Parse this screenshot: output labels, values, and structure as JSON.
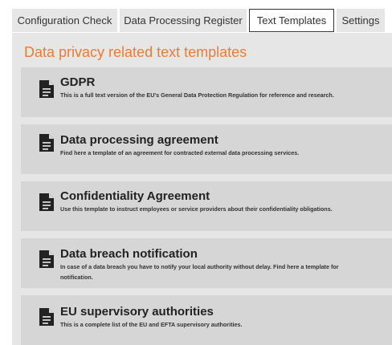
{
  "tabs": [
    {
      "label": "Configuration Check",
      "active": false
    },
    {
      "label": "Data Processing Register",
      "active": false
    },
    {
      "label": "Text Templates",
      "active": true
    },
    {
      "label": "Settings",
      "active": false
    }
  ],
  "page_title": "Data privacy related text templates",
  "accent_color": "#ee7b30",
  "templates": [
    {
      "icon": "document-icon",
      "title": "GDPR",
      "description": "This is a full text version of the EU's General Data Protection Regulation for reference and research."
    },
    {
      "icon": "document-icon",
      "title": "Data processing agreement",
      "description": "Find here a template of an agreement for contracted external data processing services."
    },
    {
      "icon": "document-icon",
      "title": "Confidentiality Agreement",
      "description": "Use this template to instruct employees or service providers about their confidentiality obligations."
    },
    {
      "icon": "document-icon",
      "title": "Data breach notification",
      "description": "In case of a data breach you have to notify your local authority without delay. Find here a template for notification."
    },
    {
      "icon": "document-icon",
      "title": "EU supervisory authorities",
      "description": "This is a complete list of the EU and EFTA supervisory authorities."
    }
  ]
}
